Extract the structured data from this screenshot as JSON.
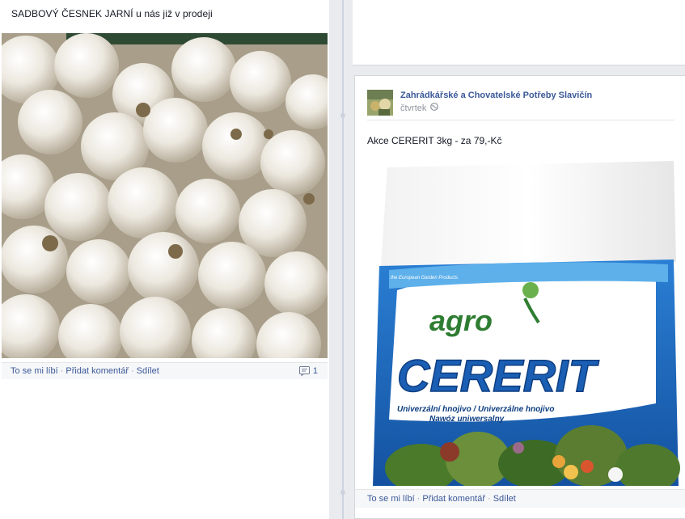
{
  "left_post": {
    "text": "SADBOVÝ ČESNEK JARNÍ u nás již v prodeji",
    "actions": {
      "like": "To se mi líbí",
      "comment": "Přidat komentář",
      "share": "Sdílet",
      "separator": "·"
    },
    "comment_count": "1"
  },
  "right_post": {
    "page_name": "Zahrádkářské a Chovatelské Potřeby Slavičín",
    "time": "čtvrtek",
    "text": "Akce CERERIT 3kg - za 79,-Kč",
    "product": {
      "brand": "agro",
      "brand_tagline": "the European Garden Products",
      "name": "CERERIT",
      "line1": "Univerzální hnojivo / Univerzálne hnojivo",
      "line2": "Nawóz uniwersalny"
    },
    "actions": {
      "like": "To se mi líbí",
      "comment": "Přidat komentář",
      "share": "Sdílet",
      "separator": "·"
    }
  },
  "colors": {
    "link": "#3b5998",
    "cererit_blue": "#1b5fb4",
    "agro_green": "#3b8a2e"
  },
  "icons": [
    "comment-icon",
    "globe-icon"
  ]
}
